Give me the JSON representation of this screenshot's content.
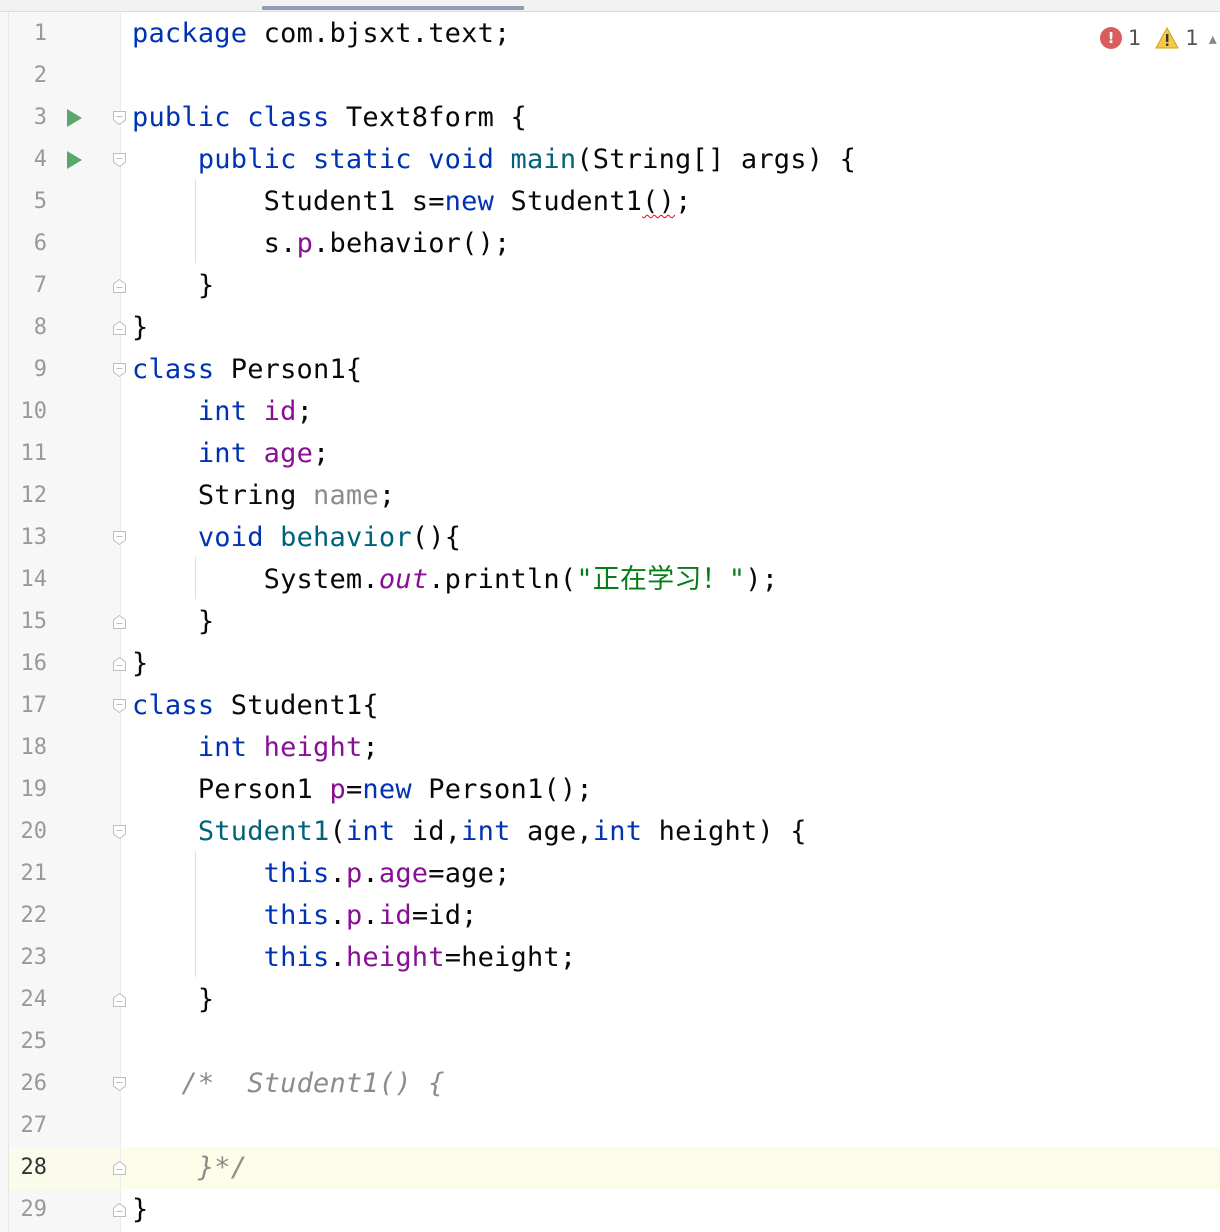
{
  "editor": {
    "inspections": {
      "errors": "1",
      "warnings": "1"
    },
    "current_line": 28,
    "lines": [
      {
        "n": "1",
        "run": false,
        "fold": "none",
        "html": "<span class=\"kw\">package</span> com.bjsxt.text;"
      },
      {
        "n": "2",
        "run": false,
        "fold": "none",
        "html": ""
      },
      {
        "n": "3",
        "run": true,
        "fold": "open",
        "html": "<span class=\"kw\">public class</span> Text8form {"
      },
      {
        "n": "4",
        "run": true,
        "fold": "open",
        "html": "    <span class=\"kw\">public static void</span> <span class=\"fn\">main</span>(String[] args) {"
      },
      {
        "n": "5",
        "run": false,
        "fold": "none",
        "html": "        Student1 s=<span class=\"kw\">new</span> Student1<span class=\"err\">()</span>;"
      },
      {
        "n": "6",
        "run": false,
        "fold": "none",
        "html": "        s.<span class=\"fld\">p</span>.behavior();"
      },
      {
        "n": "7",
        "run": false,
        "fold": "close",
        "html": "    }"
      },
      {
        "n": "8",
        "run": false,
        "fold": "close",
        "html": "}"
      },
      {
        "n": "9",
        "run": false,
        "fold": "open",
        "html": "<span class=\"kw\">class</span> Person1{"
      },
      {
        "n": "10",
        "run": false,
        "fold": "none",
        "html": "    <span class=\"kw\">int</span> <span class=\"fld\">id</span>;"
      },
      {
        "n": "11",
        "run": false,
        "fold": "none",
        "html": "    <span class=\"kw\">int</span> <span class=\"fld\">age</span>;"
      },
      {
        "n": "12",
        "run": false,
        "fold": "none",
        "html": "    String <span class=\"gry\">name</span>;"
      },
      {
        "n": "13",
        "run": false,
        "fold": "open",
        "html": "    <span class=\"kw\">void</span> <span class=\"fn\">behavior</span>(){"
      },
      {
        "n": "14",
        "run": false,
        "fold": "none",
        "html": "        System.<span class=\"itf\">out</span>.println(<span class=\"str\">\"正在学习！\"</span>);"
      },
      {
        "n": "15",
        "run": false,
        "fold": "close",
        "html": "    }"
      },
      {
        "n": "16",
        "run": false,
        "fold": "close",
        "html": "}"
      },
      {
        "n": "17",
        "run": false,
        "fold": "open",
        "html": "<span class=\"kw\">class</span> Student1{"
      },
      {
        "n": "18",
        "run": false,
        "fold": "none",
        "html": "    <span class=\"kw\">int</span> <span class=\"fld\">height</span>;"
      },
      {
        "n": "19",
        "run": false,
        "fold": "none",
        "html": "    Person1 <span class=\"fld\">p</span>=<span class=\"kw\">new</span> Person1();"
      },
      {
        "n": "20",
        "run": false,
        "fold": "open",
        "html": "    <span class=\"fn\">Student1</span>(<span class=\"kw\">int</span> id,<span class=\"kw\">int</span> age,<span class=\"kw\">int</span> height) {"
      },
      {
        "n": "21",
        "run": false,
        "fold": "none",
        "html": "        <span class=\"kw\">this</span>.<span class=\"fld\">p</span>.<span class=\"fld\">age</span>=age;"
      },
      {
        "n": "22",
        "run": false,
        "fold": "none",
        "html": "        <span class=\"kw\">this</span>.<span class=\"fld\">p</span>.<span class=\"fld\">id</span>=id;"
      },
      {
        "n": "23",
        "run": false,
        "fold": "none",
        "html": "        <span class=\"kw\">this</span>.<span class=\"fld\">height</span>=height;"
      },
      {
        "n": "24",
        "run": false,
        "fold": "close",
        "html": "    }"
      },
      {
        "n": "25",
        "run": false,
        "fold": "none",
        "html": ""
      },
      {
        "n": "26",
        "run": false,
        "fold": "open",
        "html": "   <span class=\"cmt\">/*  Student1() {</span>"
      },
      {
        "n": "27",
        "run": false,
        "fold": "none",
        "html": ""
      },
      {
        "n": "28",
        "run": false,
        "fold": "close",
        "html": "    <span class=\"cmt\">}*/</span>"
      },
      {
        "n": "29",
        "run": false,
        "fold": "close",
        "html": "}"
      }
    ]
  }
}
